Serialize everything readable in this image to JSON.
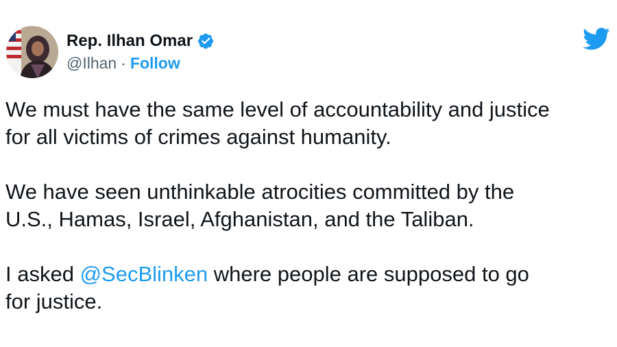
{
  "author": {
    "display_name": "Rep. Ilhan Omar",
    "handle": "@Ilhan",
    "separator": "·",
    "follow_label": "Follow"
  },
  "icons": {
    "avatar": "profile-photo",
    "verified": "verified-badge-icon",
    "logo": "twitter-bird-icon"
  },
  "colors": {
    "accent": "#1d9bf0",
    "text": "#0f1419",
    "muted": "#536471"
  },
  "tweet": {
    "paragraph_1_line_1": "We must have the same level of accountability and justice",
    "paragraph_1_line_2": "for all victims of crimes against humanity.",
    "paragraph_2_line_1": "We have seen unthinkable atrocities committed by the",
    "paragraph_2_line_2": "U.S., Hamas, Israel, Afghanistan, and the Taliban.",
    "paragraph_3_prefix": "I asked ",
    "paragraph_3_mention": "@SecBlinken",
    "paragraph_3_suffix": " where people are supposed to go",
    "paragraph_3_line_2": "for justice."
  }
}
